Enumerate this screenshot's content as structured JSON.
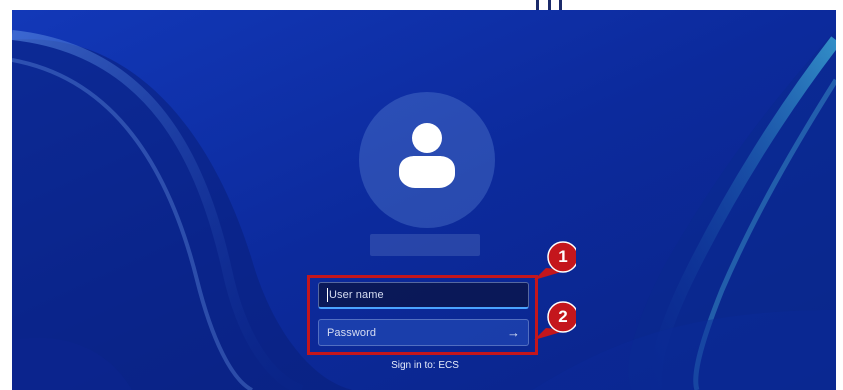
{
  "login": {
    "username_placeholder": "User name",
    "password_placeholder": "Password",
    "submit_icon": "arrow-right-icon",
    "submit_glyph": "→",
    "sign_in_text": "Sign in to: ECS"
  },
  "avatar": {
    "icon": "user-silhouette-icon"
  },
  "annotations": {
    "callout_1": "1",
    "callout_2": "2",
    "highlight_color": "#c4161c",
    "callout_color": "#c4161c"
  },
  "colors": {
    "wallpaper": "#0d2fa8",
    "focus_accent": "#4aa3ff"
  }
}
